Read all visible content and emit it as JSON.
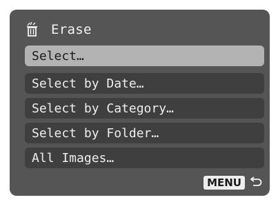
{
  "header": {
    "title": "Erase",
    "icon": "erase-icon"
  },
  "menu": {
    "items": [
      {
        "label": "Select…",
        "selected": true
      },
      {
        "label": "Select by Date…",
        "selected": false
      },
      {
        "label": "Select by Category…",
        "selected": false
      },
      {
        "label": "Select by Folder…",
        "selected": false
      },
      {
        "label": "All Images…",
        "selected": false
      }
    ]
  },
  "footer": {
    "menu_label": "MENU",
    "back_icon": "return-arrow-icon"
  },
  "colors": {
    "background": "#555555",
    "item": "#3f3f3f",
    "selected": "#b3b3b3",
    "text": "#eeeeee"
  }
}
